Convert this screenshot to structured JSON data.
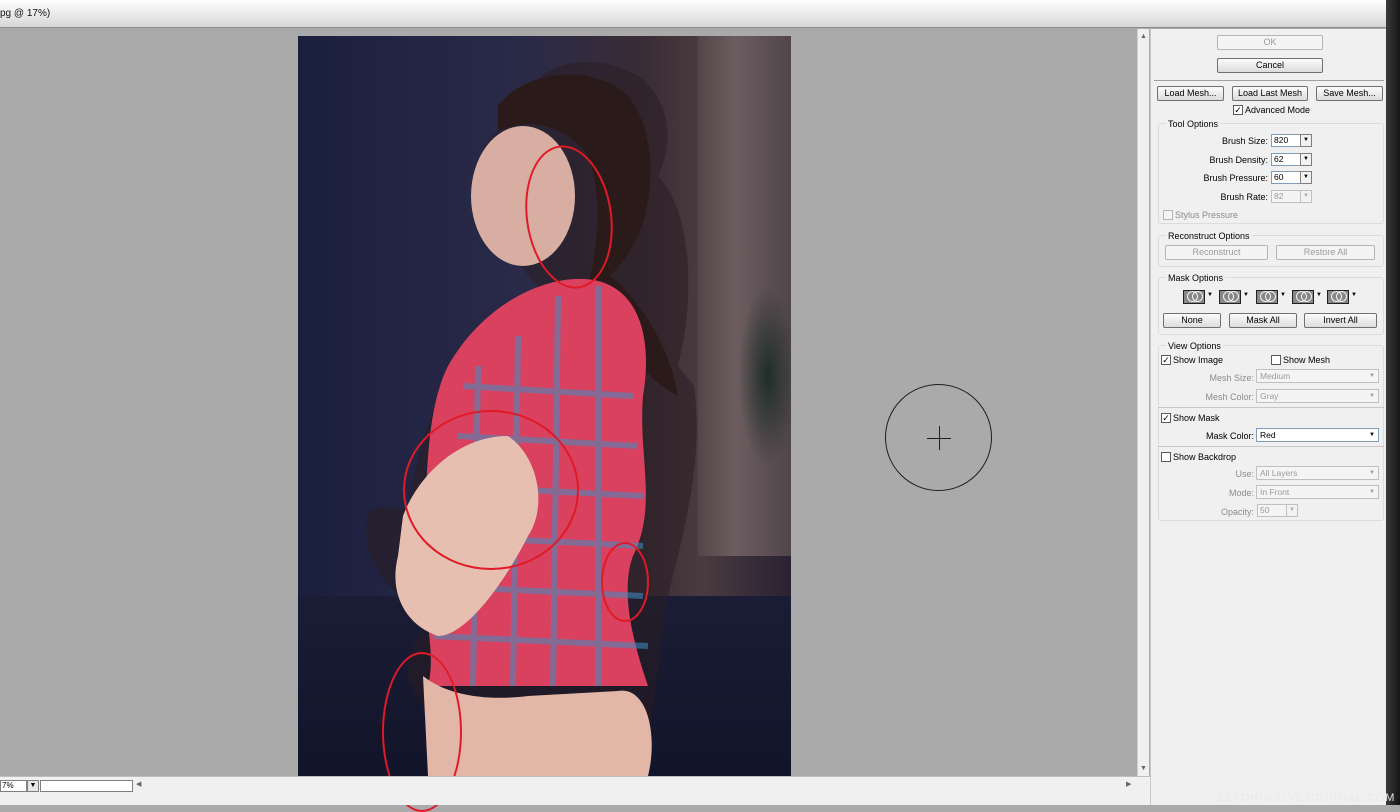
{
  "window": {
    "title": "pg @ 17%)"
  },
  "status": {
    "zoom": "7%"
  },
  "dialog": {
    "ok_label": "OK",
    "cancel_label": "Cancel",
    "load_mesh_label": "Load Mesh...",
    "load_last_mesh_label": "Load Last Mesh",
    "save_mesh_label": "Save Mesh...",
    "advanced_mode_label": "Advanced Mode",
    "advanced_mode_checked": true
  },
  "tool_options": {
    "title": "Tool Options",
    "brush_size_label": "Brush Size:",
    "brush_size": "820",
    "brush_density_label": "Brush Density:",
    "brush_density": "62",
    "brush_pressure_label": "Brush Pressure:",
    "brush_pressure": "60",
    "brush_rate_label": "Brush Rate:",
    "brush_rate": "82",
    "stylus_pressure_label": "Stylus Pressure",
    "stylus_pressure_checked": false
  },
  "reconstruct_options": {
    "title": "Reconstruct Options",
    "reconstruct_label": "Reconstruct",
    "restore_all_label": "Restore All"
  },
  "mask_options": {
    "title": "Mask Options",
    "modes": [
      "replace-selection",
      "add-to-selection",
      "subtract-from-selection",
      "intersect-with-selection",
      "invert-selection"
    ],
    "none_label": "None",
    "mask_all_label": "Mask All",
    "invert_all_label": "Invert All"
  },
  "view_options": {
    "title": "View Options",
    "show_image_label": "Show Image",
    "show_image_checked": true,
    "show_mesh_label": "Show Mesh",
    "show_mesh_checked": false,
    "mesh_size_label": "Mesh Size:",
    "mesh_size": "Medium",
    "mesh_color_label": "Mesh Color:",
    "mesh_color": "Gray",
    "show_mask_label": "Show Mask",
    "show_mask_checked": true,
    "mask_color_label": "Mask Color:",
    "mask_color": "Red",
    "show_backdrop_label": "Show Backdrop",
    "show_backdrop_checked": false,
    "use_label": "Use:",
    "use_value": "All Layers",
    "mode_label": "Mode:",
    "mode_value": "In Front",
    "opacity_label": "Opacity:",
    "opacity_value": "50"
  },
  "watermark": "LETOHIN.LIVEJOURNAL.COM",
  "colors": {
    "accent_mark": "#e01a26",
    "panel_bg": "#f0f0f0",
    "canvas_bg": "#aaaaaa"
  }
}
